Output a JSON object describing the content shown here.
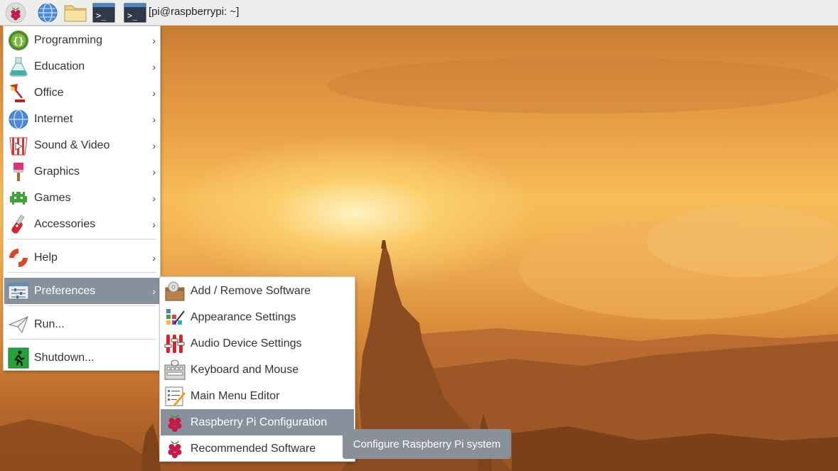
{
  "panel": {
    "task_label": "[pi@raspberrypi: ~]",
    "launchers": [
      "raspberry-menu-icon",
      "web-browser-icon",
      "file-manager-icon",
      "terminal-icon"
    ]
  },
  "main_menu": {
    "items": [
      {
        "label": "Programming",
        "icon": "programming-icon",
        "arrow": "›"
      },
      {
        "label": "Education",
        "icon": "education-icon",
        "arrow": "›"
      },
      {
        "label": "Office",
        "icon": "office-icon",
        "arrow": "›"
      },
      {
        "label": "Internet",
        "icon": "internet-globe-icon",
        "arrow": "›"
      },
      {
        "label": "Sound & Video",
        "icon": "sound-video-icon",
        "arrow": "›"
      },
      {
        "label": "Graphics",
        "icon": "graphics-brush-icon",
        "arrow": "›"
      },
      {
        "label": "Games",
        "icon": "games-invader-icon",
        "arrow": "›"
      },
      {
        "label": "Accessories",
        "icon": "accessories-knife-icon",
        "arrow": "›"
      },
      {
        "label": "Help",
        "icon": "help-lifebuoy-icon",
        "arrow": "›"
      },
      {
        "label": "Preferences",
        "icon": "preferences-icon",
        "arrow": "›",
        "selected": true
      },
      {
        "label": "Run...",
        "icon": "run-paperplane-icon"
      },
      {
        "label": "Shutdown...",
        "icon": "shutdown-exit-icon"
      }
    ]
  },
  "sub_menu": {
    "items": [
      {
        "label": "Add / Remove Software",
        "icon": "add-remove-software-icon"
      },
      {
        "label": "Appearance Settings",
        "icon": "appearance-settings-icon"
      },
      {
        "label": "Audio Device Settings",
        "icon": "audio-device-settings-icon"
      },
      {
        "label": "Keyboard and Mouse",
        "icon": "keyboard-mouse-icon"
      },
      {
        "label": "Main Menu Editor",
        "icon": "main-menu-editor-icon"
      },
      {
        "label": "Raspberry Pi Configuration",
        "icon": "raspberry-pi-config-icon",
        "selected": true
      },
      {
        "label": "Recommended Software",
        "icon": "recommended-software-icon"
      }
    ]
  },
  "tooltip": {
    "text": "Configure Raspberry Pi system"
  },
  "colors": {
    "selection": "#87919b",
    "panel": "#eeeeec",
    "tooltip": "#8a9098"
  }
}
